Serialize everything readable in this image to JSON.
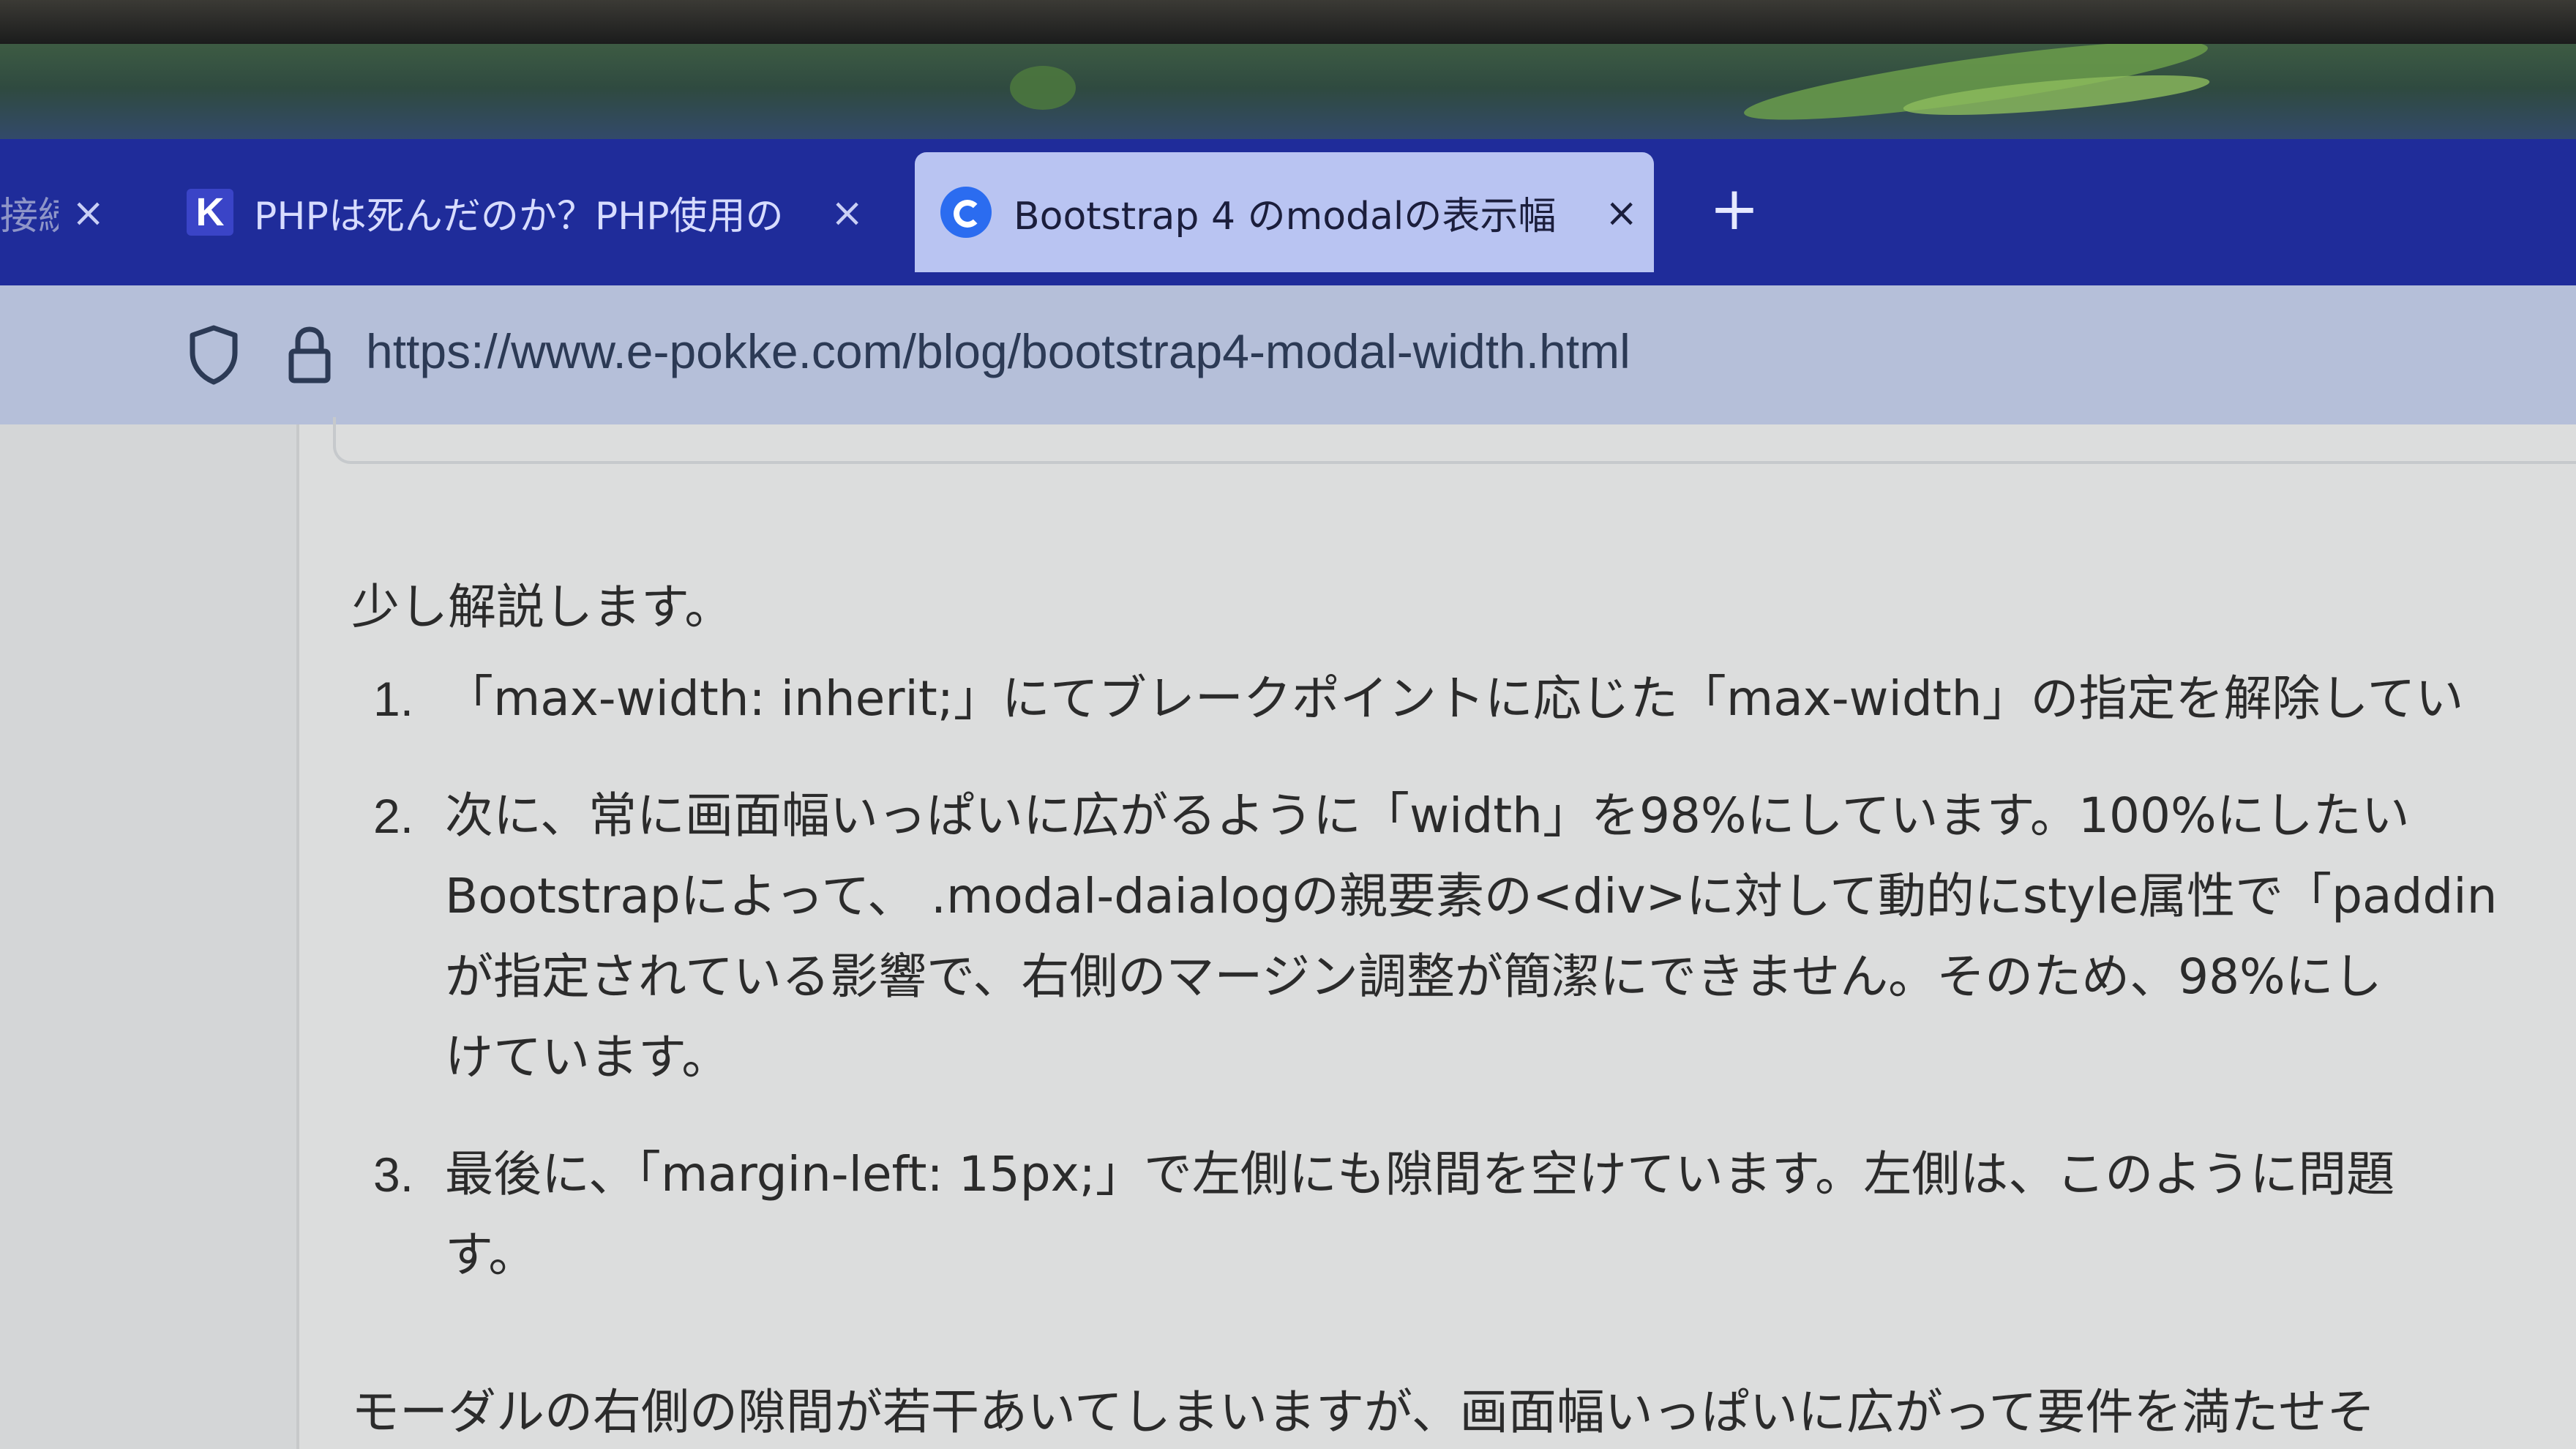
{
  "browser": {
    "tabs": [
      {
        "label": "接続",
        "close_icon": "×"
      },
      {
        "label": "PHPは死んだのか？PHP使用の",
        "favicon": "K",
        "close_icon": "×"
      },
      {
        "label": "Bootstrap 4 のmodalの表示幅",
        "close_icon": "×",
        "active": true
      }
    ],
    "new_tab_label": "+",
    "url": "https://www.e-pokke.com/blog/bootstrap4-modal-width.html"
  },
  "article": {
    "intro": "少し解説します。",
    "items": [
      {
        "number": "1.",
        "lines": [
          "「max-width: inherit;」にてブレークポイントに応じた「max-width」の指定を解除してい"
        ]
      },
      {
        "number": "2.",
        "lines": [
          "次に、常に画面幅いっぱいに広がるように「width」を98%にしています。100%にしたい",
          "Bootstrapによって、 .modal-daialogの親要素の<div>に対して動的にstyle属性で「paddin",
          "が指定されている影響で、右側のマージン調整が簡潔にできません。そのため、98%にし",
          "けています。"
        ]
      },
      {
        "number": "3.",
        "lines": [
          "最後に、「margin-left: 15px;」で左側にも隙間を空けています。左側は、このように問題",
          "す。"
        ]
      }
    ],
    "closing": "モーダルの右側の隙間が若干あいてしまいますが、画面幅いっぱいに広がって要件を満たせそ"
  }
}
